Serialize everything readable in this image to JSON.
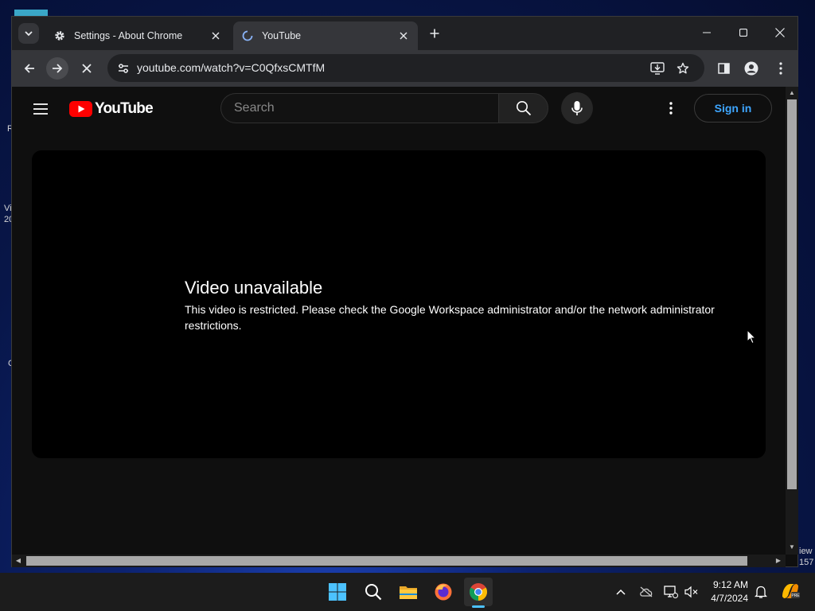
{
  "desktop": {
    "fragments": [
      "R",
      "Vi",
      "20",
      "C",
      "iew",
      "157"
    ]
  },
  "tabs": [
    {
      "title": "Settings - About Chrome",
      "icon": "gear-icon",
      "close": "×"
    },
    {
      "title": "YouTube",
      "icon": "loading-spinner-icon",
      "close": "×"
    }
  ],
  "toolbar": {
    "url": "youtube.com/watch?v=C0QfxsCMTfM"
  },
  "youtube": {
    "logo_text": "YouTube",
    "search_placeholder": "Search",
    "sign_in": "Sign in",
    "error_title": "Video unavailable",
    "error_message": "This video is restricted. Please check the Google Workspace administrator and/or the network administrator restrictions."
  },
  "taskbar": {
    "time": "9:12 AM",
    "date": "4/7/2024"
  },
  "colors": {
    "accent_blue": "#3ea6ff",
    "youtube_red": "#ff0000",
    "taskbar_active": "#4cc2ff"
  }
}
